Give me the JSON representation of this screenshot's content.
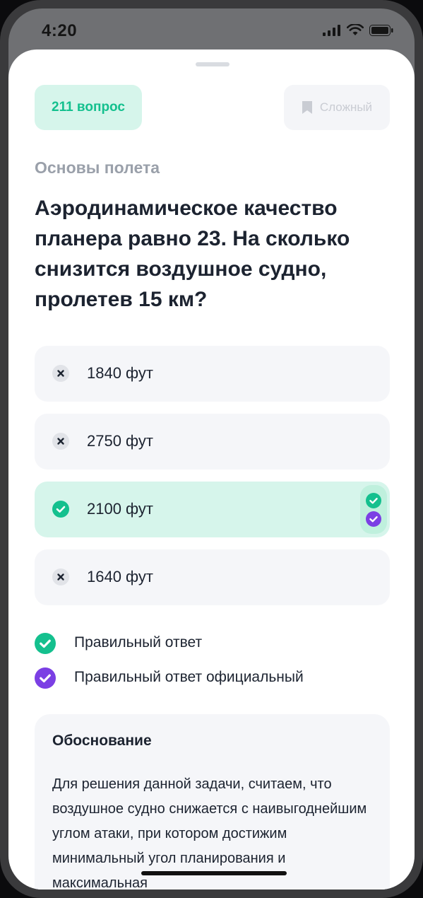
{
  "status_bar": {
    "time": "4:20"
  },
  "header": {
    "question_count": "211 вопрос",
    "hard_label": "Сложный"
  },
  "question": {
    "category": "Основы полета",
    "text": "Аэродинамическое качество планера равно 23. На сколько снизится воздушное судно, пролетев 15 км?"
  },
  "answers": [
    {
      "label": "1840 фут",
      "state": "wrong"
    },
    {
      "label": "2750 фут",
      "state": "wrong"
    },
    {
      "label": "2100 фут",
      "state": "correct"
    },
    {
      "label": "1640 фут",
      "state": "wrong"
    }
  ],
  "legend": {
    "correct": "Правильный ответ",
    "official": "Правильный ответ официальный"
  },
  "rationale": {
    "title": "Обоснование",
    "text": "Для решения данной задачи, считаем, что воздушное судно снижается с наивыгоднейшим углом атаки, при котором достижим минимальный угол планирования и максимальная"
  },
  "colors": {
    "accent_green": "#14c08e",
    "accent_purple": "#7b3fe4",
    "wrong_gray": "#e1e3e8"
  }
}
